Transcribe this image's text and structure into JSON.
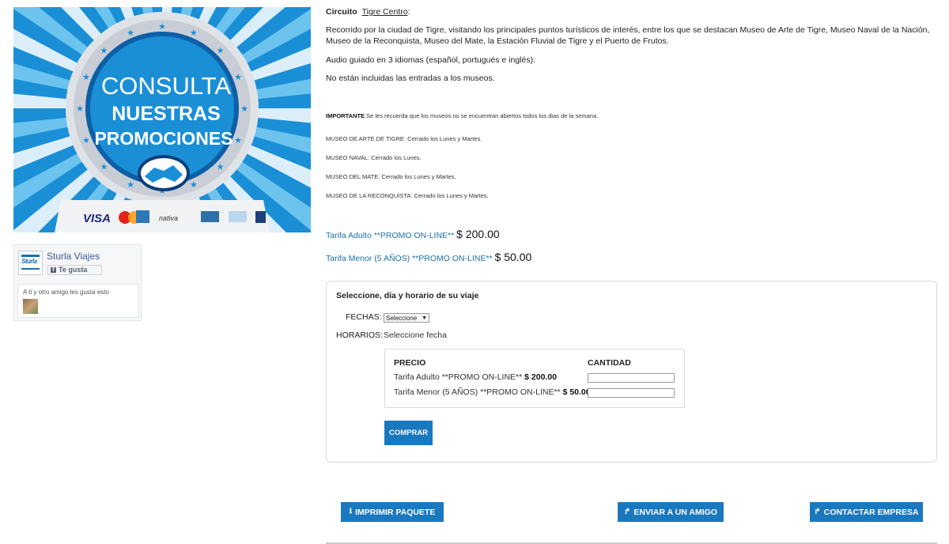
{
  "banner": {
    "line1": "CONSULTA",
    "line2": "NUESTRAS",
    "line3": "PROMOCIONES",
    "cards": [
      "VISA",
      "MasterCard",
      "AMEX",
      "nativa",
      "TARJETA NARANJA",
      "cabal",
      "diners"
    ],
    "colors": {
      "blue": "#1a8fd6",
      "light_blue": "#6cc3ee",
      "dark_blue": "#0d5fa6",
      "navy": "#0b3f7a"
    }
  },
  "facebook": {
    "logo_text": "Sturla",
    "page_name": "Sturla Viajes",
    "like_label": "Te gusta",
    "friends_text": "A ti y otro amigo les gusta esto"
  },
  "circuit": {
    "label": "Circuito",
    "name": "Tigre Centro",
    "suffix": ":"
  },
  "description": {
    "paragraph1": "Recorrido por la ciudad de Tigre, visitando los principales puntos turísticos de interés, entre los que se destacan Museo de Arte de Tigre, Museo Naval de la Nación, Museo de la Reconquista, Museo del Mate, la Estación Fluvial de Tigre y el Puerto de Frutos.",
    "paragraph2": "Audio guiado en 3 idiomas (español, portugués e inglés).",
    "paragraph3": "No están incluidas las entradas a los museos."
  },
  "important": {
    "label": "IMPORTANTE",
    "text": ":Se les recuerda que los museos no se encuentran abiertos todos los dias de la semana.",
    "museums": [
      "MUSEO DE ARTE DE TIGRE: Cerrado los Lunes y Martes.",
      "MUSEO NAVAL: Cerrado los Lunes.",
      "MUSEO DEL MATE: Cerrado los Lunes y Martes.",
      "MUSEO DE LA RECONQUISTA: Cerrado los Lunes y Martes."
    ]
  },
  "tarifas": [
    {
      "label": "Tarifa Adulto **PROMO ON-LINE**",
      "price": "$ 200.00"
    },
    {
      "label": "Tarifa Menor (5 AÑOS) **PROMO ON-LINE**",
      "price": "$ 50.00"
    }
  ],
  "booking": {
    "title": "Seleccione, día y horario de su viaje",
    "fechas_label": "FECHAS:",
    "fechas_value": "Seleccione",
    "horarios_label": "HORARIOS:",
    "horarios_value": "Seleccione fecha",
    "price_header": "PRECIO",
    "qty_header": "CANTIDAD",
    "rows": [
      {
        "label": "Tarifa Adulto **PROMO ON-LINE**",
        "price": "$ 200.00",
        "qty": ""
      },
      {
        "label": "Tarifa Menor (5 AÑOS) **PROMO ON-LINE**",
        "price": "$ 50.00",
        "qty": ""
      }
    ],
    "buy_label": "COMPRAR"
  },
  "actions": {
    "print_label": "IMPRIMIR PAQUETE",
    "send_label": "ENVIAR A UN AMIGO",
    "contact_label": "CONTACTAR EMPRESA"
  },
  "icons": {
    "print": "download-icon",
    "send": "share-arrow-icon",
    "contact": "share-arrow-icon"
  },
  "accent_color": "#1a78bf"
}
